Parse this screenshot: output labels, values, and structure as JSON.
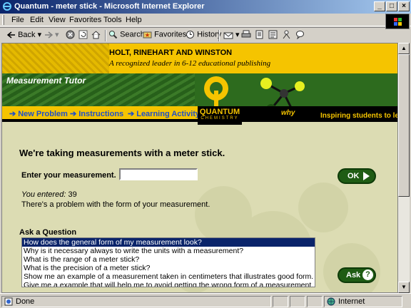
{
  "window": {
    "title": "Quantum - meter stick - Microsoft Internet Explorer"
  },
  "menu": [
    "File",
    "Edit",
    "View",
    "Favorites",
    "Tools",
    "Help"
  ],
  "toolbar": {
    "back": "Back",
    "search": "Search",
    "favorites": "Favorites",
    "history": "History"
  },
  "banner": {
    "publisher": "HOLT, RINEHART AND WINSTON",
    "tagline": "A recognized leader in 6-12 educational publishing",
    "tutor": "Measurement Tutor",
    "brand": "QUANTUM",
    "brand_sub": "CHEMISTRY",
    "inspire_prefix": "Inspiring students to learn ",
    "inspire_em": "why",
    "nav": [
      "New Problem",
      "Instructions",
      "Learning Activity"
    ]
  },
  "content": {
    "heading": "We're taking measurements with a meter stick.",
    "enter_label": "Enter your measurement.",
    "input_value": "",
    "ok_label": "OK",
    "entered_label": "You entered:",
    "entered_value": "39",
    "problem": "There's a problem with the form of your measurement.",
    "ask_label": "Ask a Question",
    "questions": [
      "How does the general form of my measurement look?",
      "Why is it necessary always to write the units with a measurement?",
      "What is the range of a meter stick?",
      "What is the precision of a meter stick?",
      "Show me an example of a measurement taken in centimeters that illustrates good form.",
      "Give me a example that will help me to avoid getting the wrong form of a measurement."
    ],
    "ask_button": "Ask"
  },
  "status": {
    "left": "Done",
    "zone": "Internet"
  },
  "colors": {
    "banner_yellow": "#f5c400",
    "banner_green": "#2d6b1e",
    "nav_link": "#1f4fc8",
    "page_bg": "#dcdcb3"
  }
}
